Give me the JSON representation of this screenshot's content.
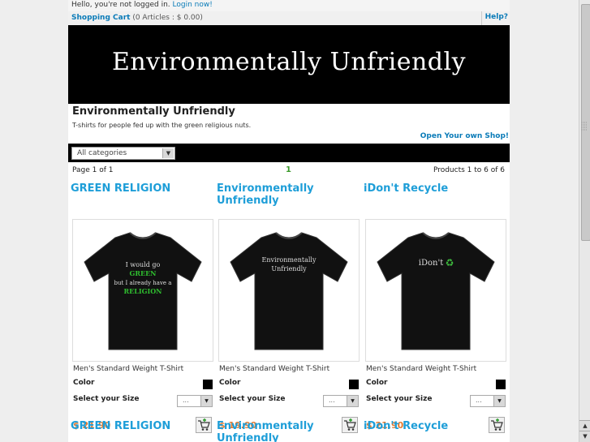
{
  "header": {
    "greeting": "Hello, you're not logged in.",
    "login_link": "Login now!",
    "cart_label": "Shopping Cart",
    "cart_summary": "(0 Articles : $ 0.00)",
    "help_label": "Help?"
  },
  "banner": {
    "title": "Environmentally Unfriendly"
  },
  "shop": {
    "name": "Environmentally Unfriendly",
    "description": "T-shirts for people fed up with the green religious nuts.",
    "open_shop_link": "Open Your own Shop!"
  },
  "category_select": {
    "value": "All categories"
  },
  "pagination": {
    "page_label": "Page 1 of 1",
    "current_page": "1",
    "products_label": "Products 1 to 6 of 6"
  },
  "products": [
    {
      "title": "GREEN RELIGION",
      "type": "Men's Standard Weight T-Shirt",
      "color_label": "Color",
      "size_label": "Select your Size",
      "size_value": "...",
      "price": "$ 21.90",
      "shirt_lines": [
        "I would go",
        "GREEN",
        "but I already have a",
        "RELIGION"
      ]
    },
    {
      "title": "Environmentally Unfriendly",
      "type": "Men's Standard Weight T-Shirt",
      "color_label": "Color",
      "size_label": "Select your Size",
      "size_value": "...",
      "price": "$ 19.90",
      "shirt_lines": [
        "Environmentally",
        "Unfriendly"
      ]
    },
    {
      "title": "iDon't Recycle",
      "type": "Men's Standard Weight T-Shirt",
      "color_label": "Color",
      "size_label": "Select your Size",
      "size_value": "...",
      "price": "$ 21.90",
      "shirt_lines": [
        "iDon't",
        "♻"
      ]
    }
  ],
  "colors": {
    "link": "#0a7bb8",
    "title": "#1e9ed8",
    "green": "#3a9a2a",
    "price": "#e67a2d",
    "banner_bg": "#000000"
  }
}
